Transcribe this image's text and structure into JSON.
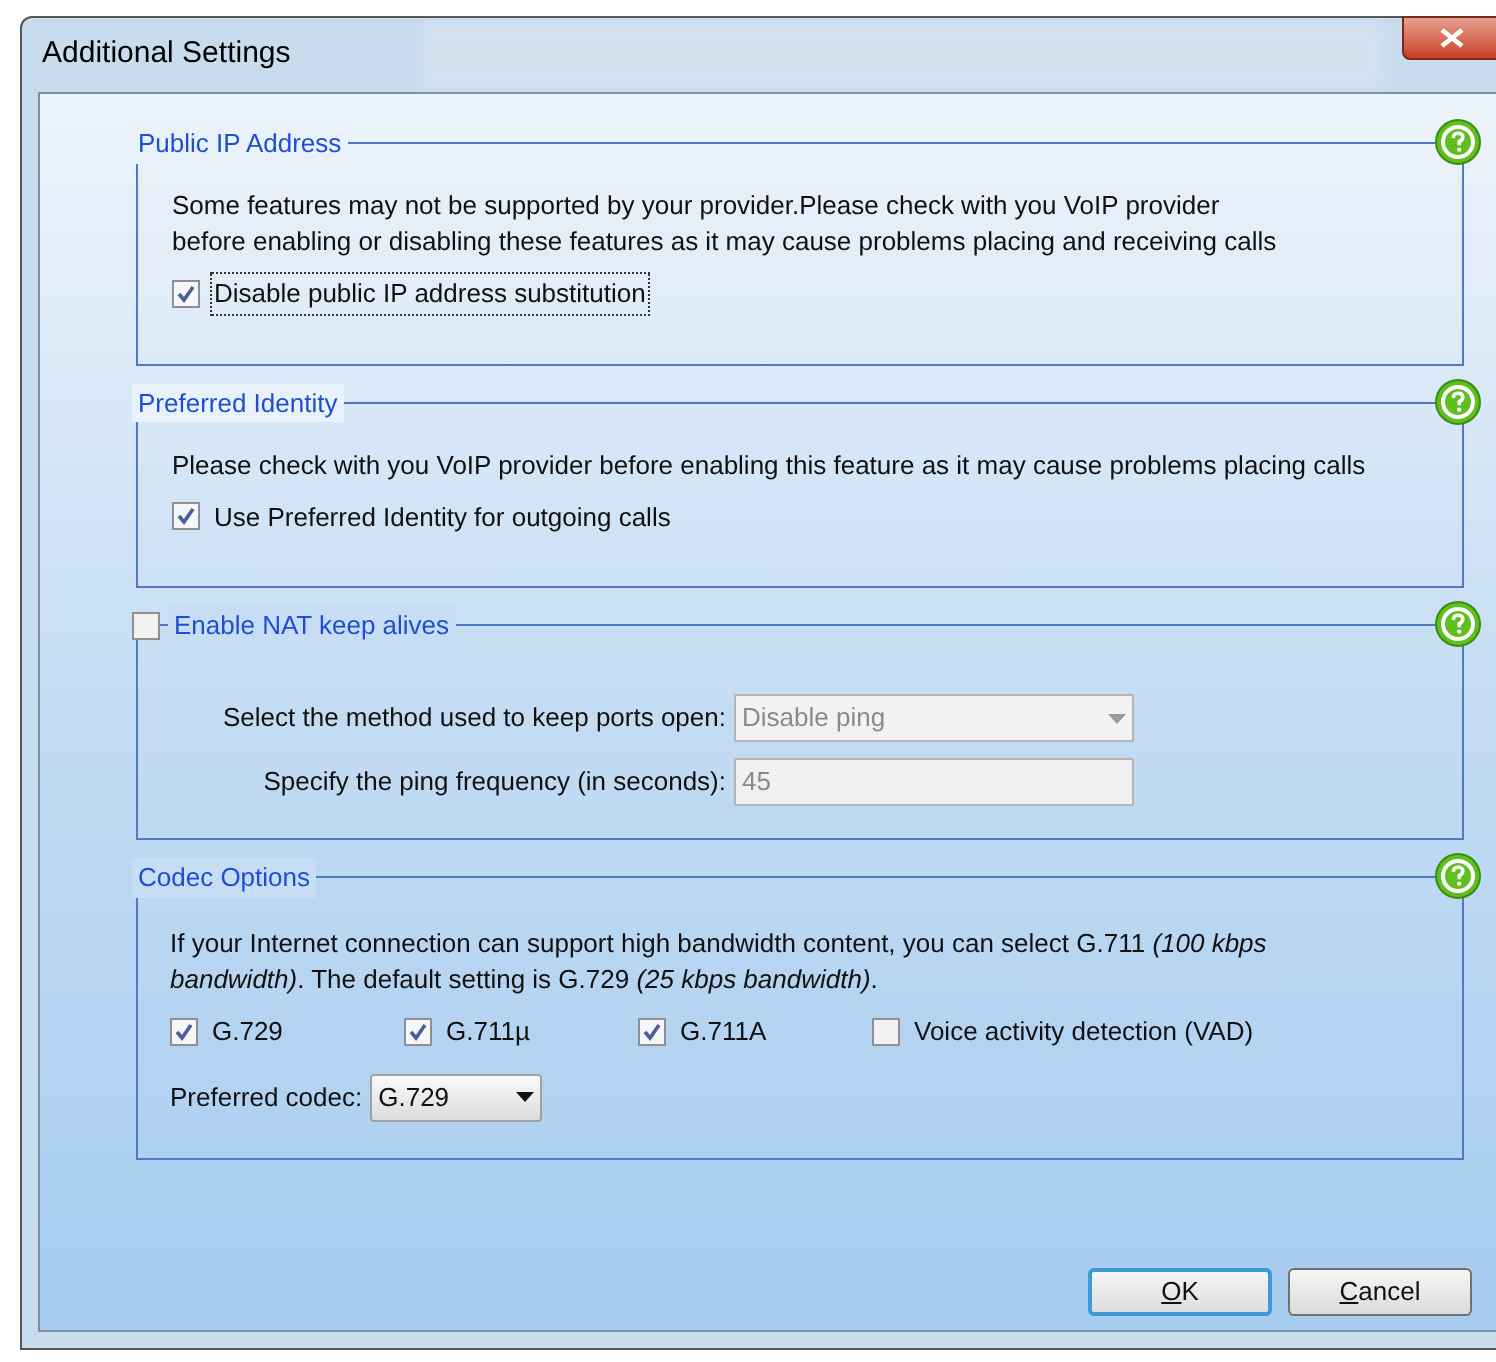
{
  "window": {
    "title": "Additional Settings"
  },
  "sections": [
    {
      "kind": "plain",
      "title": "Public IP Address",
      "text": "Some features may not be supported by your provider.Please check with you VoIP provider\nbefore enabling or disabling these features as it may cause problems placing and receiving calls",
      "options": [
        {
          "label": "Disable public IP address substitution",
          "checked": true,
          "focused": true
        }
      ]
    },
    {
      "kind": "plain",
      "title": "Preferred Identity",
      "text": "Please check with you VoIP provider before enabling this feature as it may cause problems placing calls",
      "options": [
        {
          "label": "Use Preferred Identity for outgoing calls",
          "checked": true,
          "focused": false
        }
      ]
    },
    {
      "kind": "checkbox",
      "title": "Enable NAT keep alives",
      "checked": false,
      "fields": [
        {
          "kind": "select",
          "label": "Select the method used to keep ports open:",
          "value": "Disable ping",
          "disabled": true
        },
        {
          "kind": "input",
          "label": "Specify the ping frequency (in seconds):",
          "value": "45",
          "disabled": true
        }
      ]
    },
    {
      "kind": "codec",
      "title": "Codec Options",
      "text": "If your Internet connection can support high bandwidth content, you can select G.711 *(100 kbps bandwidth)*. The default setting is G.729 *(25 kbps bandwidth)*.",
      "codecs": [
        {
          "label": "G.729",
          "checked": true
        },
        {
          "label": "G.711µ",
          "checked": true
        },
        {
          "label": "G.711A",
          "checked": true
        },
        {
          "label": "Voice activity detection (VAD)",
          "checked": false
        }
      ],
      "preferred": {
        "label": "Preferred codec:",
        "value": "G.729"
      }
    }
  ],
  "buttons": [
    {
      "label": "OK",
      "default": true
    },
    {
      "label": "Cancel",
      "default": false
    }
  ]
}
